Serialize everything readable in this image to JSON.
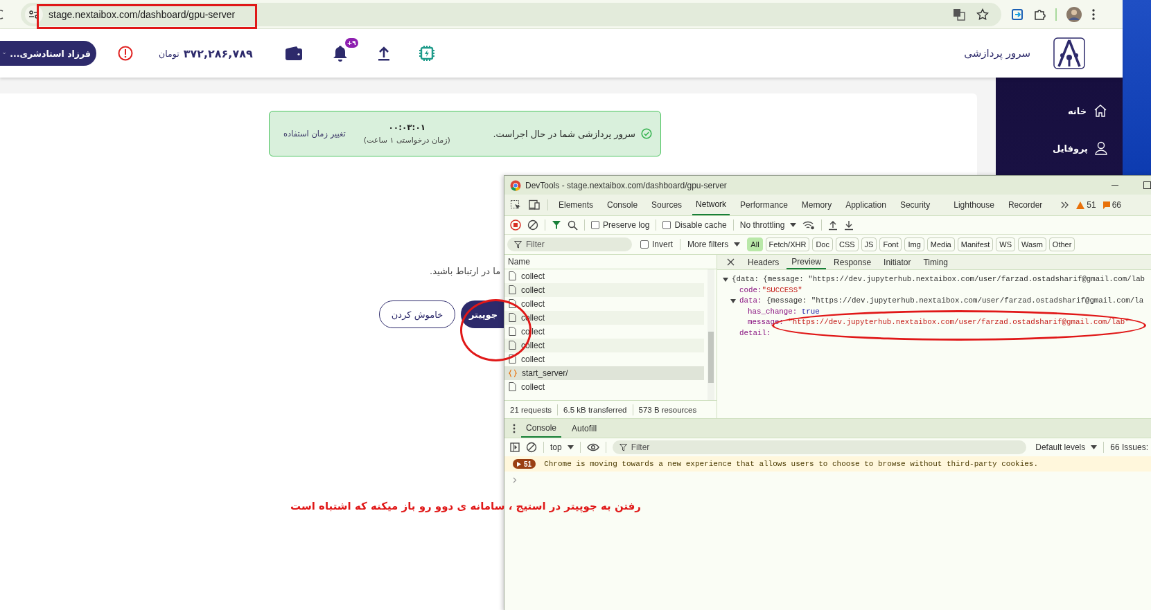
{
  "browser": {
    "url": "stage.nextaibox.com/dashboard/gpu-server"
  },
  "header": {
    "user_name": "فرزاد استادشری...",
    "balance": "۳۷۲,۲۸۶,۷۸۹",
    "currency": "تومان",
    "notification_badge": "+۹",
    "title": "سرور پردازشی"
  },
  "sidebar": {
    "items": [
      {
        "label": "خانه",
        "kind": "home"
      },
      {
        "label": "پروفایل",
        "kind": "user"
      }
    ]
  },
  "status_banner": {
    "message": "سرور پردازشی شما در حال اجراست.",
    "timer": "۰۰:۰۳:۰۱",
    "requested": "(زمان درخواستی ۱ ساعت)",
    "change_link": "تغییر زمان استفاده"
  },
  "notice_text": "ما در ارتباط باشید.",
  "buttons": [
    {
      "label": "جوپیتر",
      "kind": "primary"
    },
    {
      "label": "خاموش کردن",
      "kind": "outline"
    }
  ],
  "devtools": {
    "title": "DevTools - stage.nextaibox.com/dashboard/gpu-server",
    "tabs": [
      {
        "label": "Elements",
        "selected": false
      },
      {
        "label": "Console",
        "selected": false
      },
      {
        "label": "Sources",
        "selected": false
      },
      {
        "label": "Network",
        "selected": true
      },
      {
        "label": "Performance",
        "selected": false
      },
      {
        "label": "Memory",
        "selected": false
      },
      {
        "label": "Application",
        "selected": false
      },
      {
        "label": "Security",
        "selected": false
      },
      {
        "label": "Lighthouse",
        "selected": false
      },
      {
        "label": "Recorder",
        "selected": false
      }
    ],
    "warnings": "51",
    "errors": "66",
    "options": [
      {
        "label": "Preserve log",
        "checked": false
      },
      {
        "label": "Disable cache",
        "checked": false
      }
    ],
    "throttling": "No throttling",
    "filter": {
      "placeholder": "Filter",
      "invert": {
        "label": "Invert",
        "checked": false
      },
      "more_filters": "More filters",
      "types": [
        {
          "label": "All",
          "selected": true
        },
        {
          "label": "Fetch/XHR",
          "selected": false
        },
        {
          "label": "Doc",
          "selected": false
        },
        {
          "label": "CSS",
          "selected": false
        },
        {
          "label": "JS",
          "selected": false
        },
        {
          "label": "Font",
          "selected": false
        },
        {
          "label": "Img",
          "selected": false
        },
        {
          "label": "Media",
          "selected": false
        },
        {
          "label": "Manifest",
          "selected": false
        },
        {
          "label": "WS",
          "selected": false
        },
        {
          "label": "Wasm",
          "selected": false
        },
        {
          "label": "Other",
          "selected": false
        }
      ]
    },
    "requests": {
      "header": "Name",
      "rows": [
        {
          "name": "collect",
          "kind": "doc",
          "selected": false
        },
        {
          "name": "collect",
          "kind": "doc",
          "selected": false
        },
        {
          "name": "collect",
          "kind": "doc",
          "selected": false
        },
        {
          "name": "collect",
          "kind": "doc",
          "selected": false
        },
        {
          "name": "collect",
          "kind": "doc",
          "selected": false
        },
        {
          "name": "collect",
          "kind": "doc",
          "selected": false
        },
        {
          "name": "collect",
          "kind": "doc",
          "selected": false
        },
        {
          "name": "start_server/",
          "kind": "fetch",
          "selected": true
        },
        {
          "name": "collect",
          "kind": "doc",
          "selected": false
        }
      ]
    },
    "summary": [
      "21 requests",
      "6.5 kB transferred",
      "573 B resources"
    ],
    "detail_tabs": [
      {
        "label": "Headers",
        "selected": false
      },
      {
        "label": "Preview",
        "selected": true
      },
      {
        "label": "Response",
        "selected": false
      },
      {
        "label": "Initiator",
        "selected": false
      },
      {
        "label": "Timing",
        "selected": false
      }
    ],
    "preview": {
      "summary": "{data: {message: \"https://dev.jupyterhub.nextaibox.com/user/farzad.ostadsharif@gmail.com/lab",
      "expanded": true,
      "children": [
        {
          "key": "code:",
          "value": "\"SUCCESS\"",
          "kind": "string"
        },
        {
          "key": "data:",
          "summary": "{message: \"https://dev.jupyterhub.nextaibox.com/user/farzad.ostadsharif@gmail.com/la",
          "expanded": true,
          "children": [
            {
              "key": "has_change:",
              "value": "true",
              "kind": "bool"
            },
            {
              "key": "message:",
              "value": "\"https://dev.jupyterhub.nextaibox.com/user/farzad.ostadsharif@gmail.com/lab\"",
              "kind": "string"
            }
          ]
        },
        {
          "key": "detail:"
        }
      ]
    },
    "console": {
      "tabs": [
        {
          "label": "Console",
          "selected": true
        },
        {
          "label": "Autofill",
          "selected": false
        }
      ],
      "context": "top",
      "filter_placeholder": "Filter",
      "levels": "Default levels",
      "issues": "66 Issues:",
      "messages": [
        {
          "kind": "warning",
          "count": "51",
          "text": "Chrome is moving towards a new experience that allows users to choose to browse without third-party cookies."
        }
      ]
    }
  },
  "annotation": {
    "note": "رفتن به جوپیتر در استیج ، سامانه ی دوو رو باز میکنه که اشتباه است"
  }
}
